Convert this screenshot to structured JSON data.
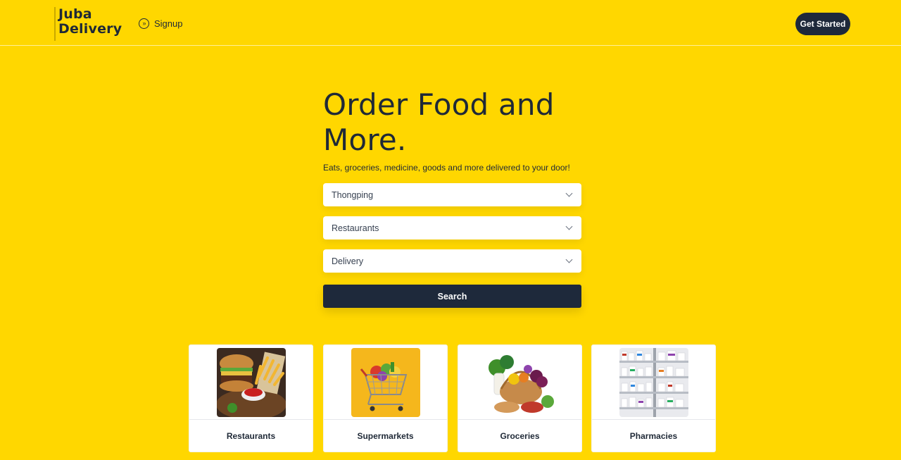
{
  "header": {
    "logo_line1": "Juba",
    "logo_line2": "Delivery",
    "signup_label": "Signup",
    "get_started_label": "Get Started"
  },
  "hero": {
    "title": "Order Food and More.",
    "subtitle": "Eats, groceries, medicine, goods and more delivered to your door!"
  },
  "filters": {
    "location": "Thongping",
    "category": "Restaurants",
    "mode": "Delivery"
  },
  "search_label": "Search",
  "categories": [
    {
      "label": "Restaurants",
      "icon": "burger-fries-image"
    },
    {
      "label": "Supermarkets",
      "icon": "shopping-cart-image"
    },
    {
      "label": "Groceries",
      "icon": "grocery-basket-image"
    },
    {
      "label": "Pharmacies",
      "icon": "pharmacy-shelves-image"
    }
  ],
  "colors": {
    "background": "#FFD700",
    "dark": "#1E293B",
    "text": "#1F2937"
  }
}
